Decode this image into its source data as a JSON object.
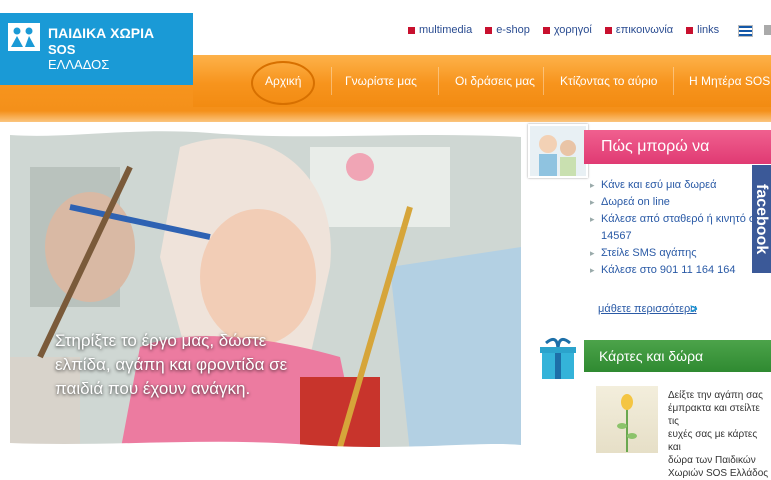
{
  "logo": {
    "line1": "ΠΑΙΔΙΚΑ ΧΩΡΙΑ",
    "line2": "SOS",
    "line3": "ΕΛΛΑΔΟΣ"
  },
  "top_links": [
    "multimedia",
    "e-shop",
    "χορηγοί",
    "επικοινωνία",
    "links"
  ],
  "nav": {
    "items": [
      "Αρχική",
      "Γνωρίστε μας",
      "Οι δράσεις μας",
      "Κτίζοντας το αύριο",
      "Η Μητέρα SOS"
    ]
  },
  "hero": {
    "caption_lines": [
      "Στηρίξτε το έργο μας, δώστε",
      "ελπίδα, αγάπη και φροντίδα σε",
      "παιδιά που έχουν ανάγκη."
    ]
  },
  "help": {
    "title": "Πώς μπορώ να βοηθήσω",
    "items": [
      "Κάνε και εσύ μια δωρεά",
      "Δωρεά on line",
      "Κάλεσε από σταθερό ή κινητό στο",
      "14567",
      "Στείλε SMS αγάπης",
      "Κάλεσε στο 901 11 164 164"
    ],
    "more": "μάθετε περισσότερα"
  },
  "facebook": "facebook",
  "cards": {
    "title": "Κάρτες και δώρα",
    "text_lines": [
      "Δείξτε την αγάπη σας",
      "έμπρακτα και στείλτε τις",
      "ευχές σας με κάρτες και",
      "δώρα των Παιδικών",
      "Χωριών SOS Ελλάδος"
    ]
  }
}
